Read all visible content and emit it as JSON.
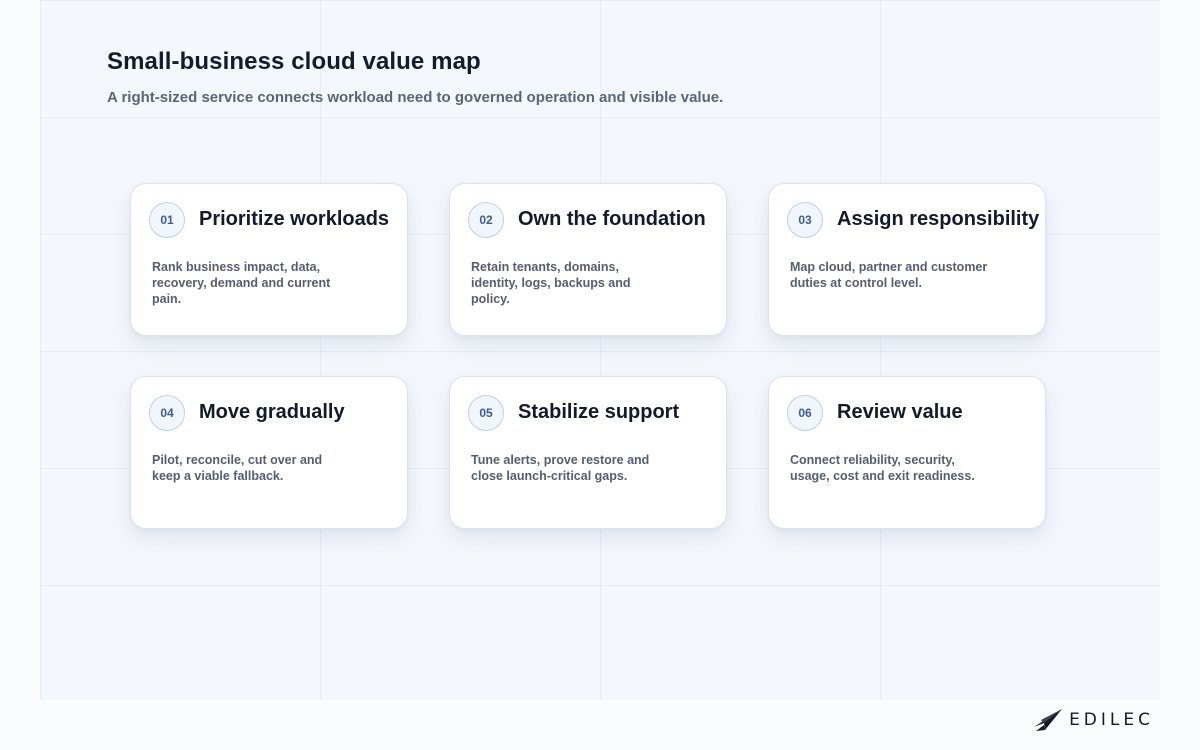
{
  "header": {
    "title": "Small-business cloud value map",
    "subtitle": "A right-sized service connects workload need to governed operation and visible value."
  },
  "cards": [
    {
      "number": "01",
      "title": "Prioritize workloads",
      "text": "Rank business impact, data, recovery, demand and current pain."
    },
    {
      "number": "02",
      "title": "Own the foundation",
      "text": "Retain tenants, domains, identity, logs, backups and policy."
    },
    {
      "number": "03",
      "title": "Assign responsibility",
      "text": "Map cloud, partner and customer duties at control level."
    },
    {
      "number": "04",
      "title": "Move gradually",
      "text": "Pilot, reconcile, cut over and keep a viable fallback."
    },
    {
      "number": "05",
      "title": "Stabilize support",
      "text": "Tune alerts, prove restore and close launch-critical gaps."
    },
    {
      "number": "06",
      "title": "Review value",
      "text": "Connect reliability, security, usage, cost and exit readiness."
    }
  ],
  "branding": {
    "logo_text": "EDILEC",
    "logo_icon": "paper-plane-icon"
  },
  "colors": {
    "badge_accent": "#3a5c93",
    "badge_border": "#bcd0ec",
    "title_text": "#131b2c",
    "body_text": "#555e70"
  }
}
